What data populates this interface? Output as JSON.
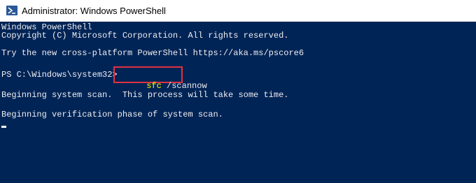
{
  "window": {
    "title": "Administrator: Windows PowerShell",
    "icon": "powershell-icon"
  },
  "console": {
    "lines": [
      "Windows PowerShell",
      "Copyright (C) Microsoft Corporation. All rights reserved.",
      "Try the new cross-platform PowerShell https://aka.ms/pscore6",
      "Beginning system scan.  This process will take some time.",
      "Beginning verification phase of system scan."
    ],
    "prompt": "PS C:\\Windows\\system32>",
    "command_exe": "sfc",
    "command_args": " /scannow"
  },
  "colors": {
    "background": "#012456",
    "text": "#eeedf0",
    "command_highlight": "#ffff00",
    "annotation_box": "#e03241"
  }
}
